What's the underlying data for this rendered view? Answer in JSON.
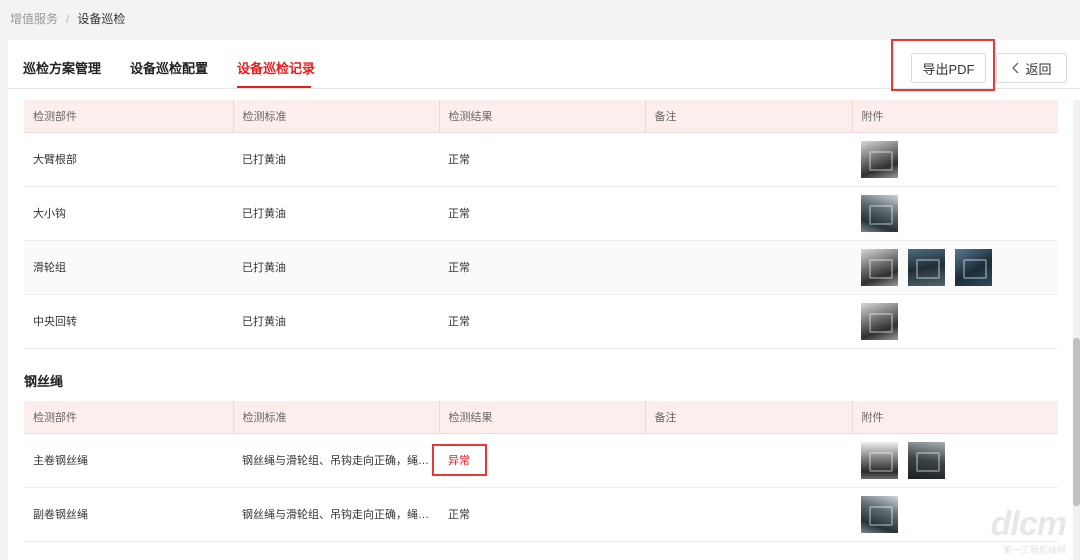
{
  "breadcrumb": {
    "parent": "增值服务",
    "separator": "/",
    "current": "设备巡检"
  },
  "tabs": [
    {
      "label": "巡检方案管理",
      "active": false
    },
    {
      "label": "设备巡检配置",
      "active": false
    },
    {
      "label": "设备巡检记录",
      "active": true
    }
  ],
  "actions": {
    "export_label": "导出PDF",
    "back_label": "返回",
    "back_icon": "chevron-left-icon"
  },
  "columns": [
    "检测部件",
    "检测标准",
    "检测结果",
    "备注",
    "附件"
  ],
  "table1": {
    "rows": [
      {
        "part": "大臂根部",
        "standard": "已打黄油",
        "result": "正常",
        "note": ""
      },
      {
        "part": "大小钩",
        "standard": "已打黄油",
        "result": "正常",
        "note": ""
      },
      {
        "part": "滑轮组",
        "standard": "已打黄油",
        "result": "正常",
        "note": ""
      },
      {
        "part": "中央回转",
        "standard": "已打黄油",
        "result": "正常",
        "note": ""
      }
    ]
  },
  "section2": {
    "title": "钢丝绳"
  },
  "table2": {
    "rows": [
      {
        "part": "主卷钢丝绳",
        "standard": "钢丝绳与滑轮组、吊钩走向正确，绳头…",
        "result": "异常",
        "note": ""
      },
      {
        "part": "副卷钢丝绳",
        "standard": "钢丝绳与滑轮组、吊钩走向正确，绳头…",
        "result": "正常",
        "note": ""
      }
    ]
  },
  "colors": {
    "accent": "#e02020",
    "header_bg": "#fdeeee",
    "abnormal": "#e02020"
  },
  "watermark": {
    "logo": "dlcm",
    "caption": "第一工程机械网"
  }
}
